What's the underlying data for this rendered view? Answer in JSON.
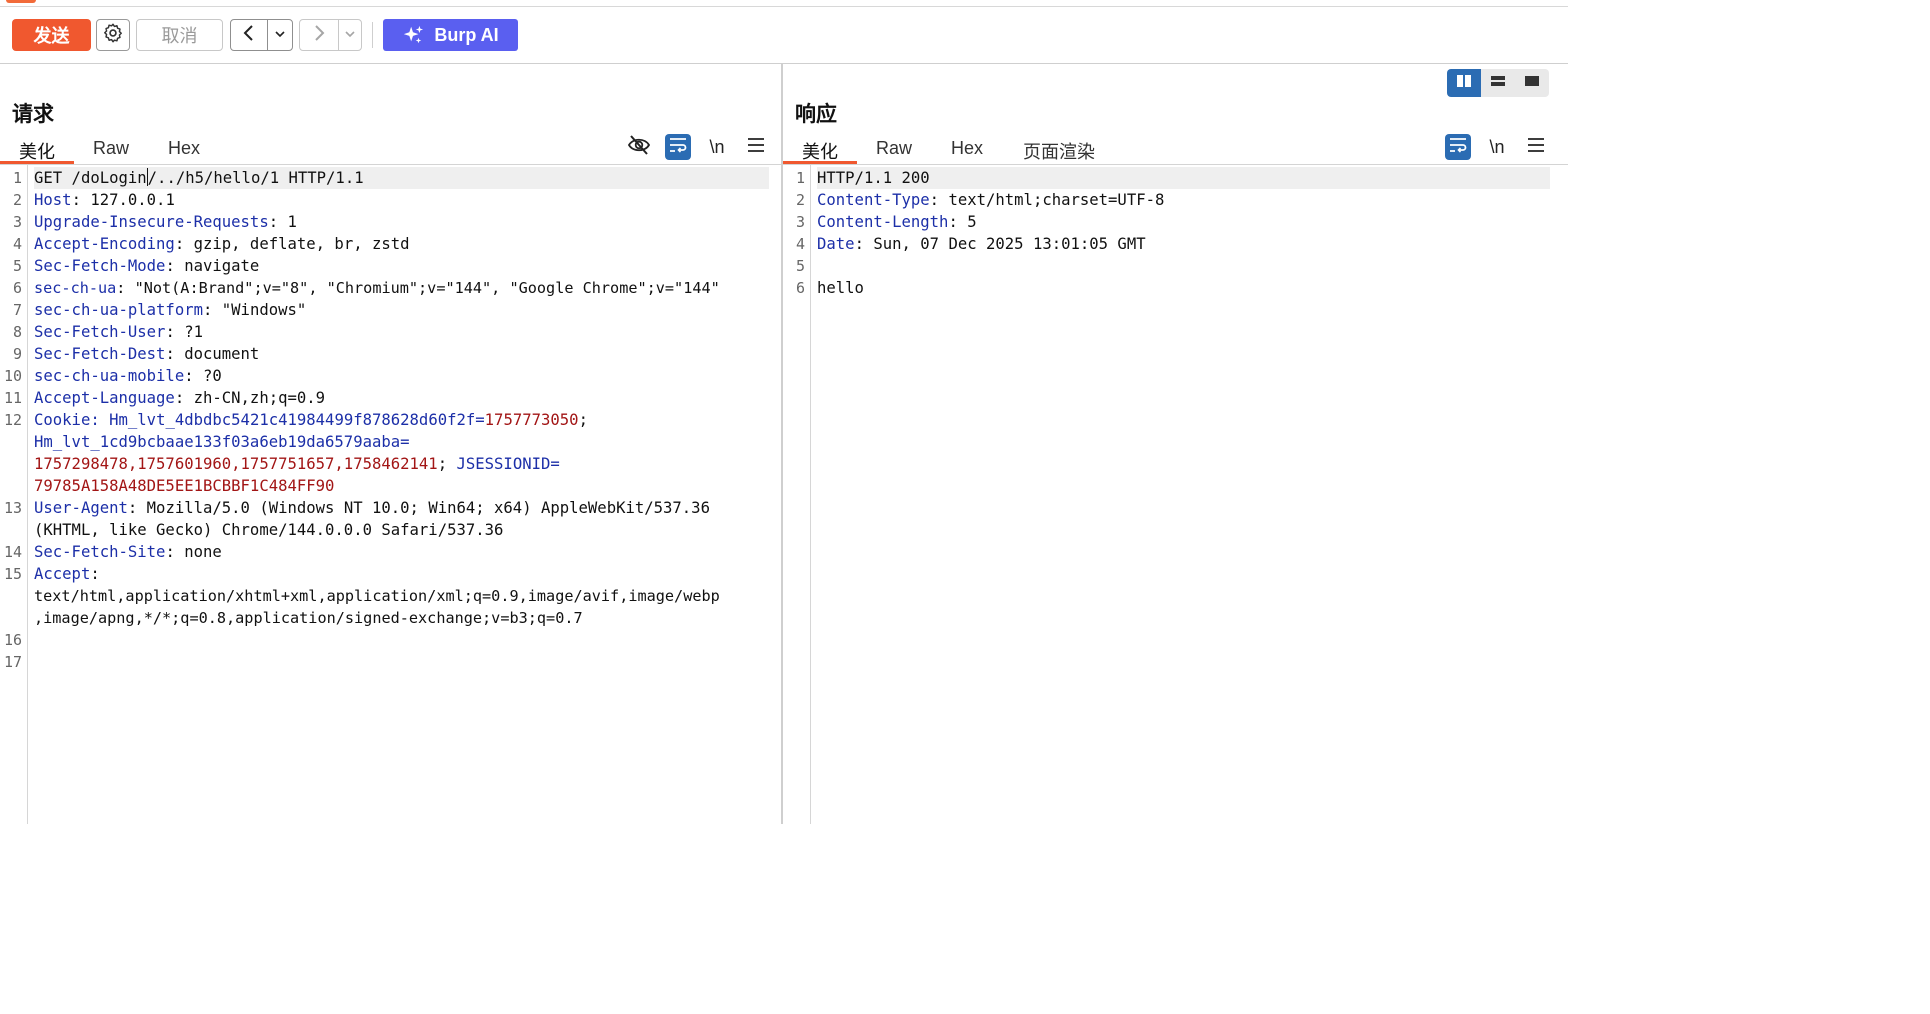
{
  "toolbar": {
    "send_label": "发送",
    "cancel_label": "取消",
    "ai_label": "Burp AI"
  },
  "request": {
    "title": "请求",
    "tabs": [
      "美化",
      "Raw",
      "Hex"
    ],
    "active_tab": "美化",
    "newline_toggle_label": "\\n",
    "line_numbers": [
      "1",
      "2",
      "3",
      "4",
      "5",
      "6",
      "7",
      "8",
      "9",
      "10",
      "11",
      "12",
      "13",
      "14",
      "15",
      "16",
      "17"
    ],
    "lines": {
      "l1a": "GET /doLogin",
      "l1b": "/../h5/hello/1 HTTP/1.1",
      "l2k": "Host",
      "l2v": ": 127.0.0.1",
      "l3k": "Upgrade-Insecure-Requests",
      "l3v": ": 1",
      "l4k": "Accept-Encoding",
      "l4v": ": gzip, deflate, br, zstd",
      "l5k": "Sec-Fetch-Mode",
      "l5v": ": navigate",
      "l6k": "sec-ch-ua",
      "l6v": ": \"Not(A:Brand\";v=\"8\", \"Chromium\";v=\"144\", \"Google Chrome\";v=\"144\"",
      "l7k": "sec-ch-ua-platform",
      "l7v": ": \"Windows\"",
      "l8k": "Sec-Fetch-User",
      "l8v": ": ?1",
      "l9k": "Sec-Fetch-Dest",
      "l9v": ": document",
      "l10k": "sec-ch-ua-mobile",
      "l10v": ": ?0",
      "l11k": "Accept-Language",
      "l11v": ": zh-CN,zh;q=0.9",
      "l12k": "Cookie",
      "l12sep": ": ",
      "c1k": "Hm_lvt_4dbdbc5421c41984499f878628d60f2f",
      "c1eq": "=",
      "c1v": "1757773050",
      "c1end": ";",
      "c2k": "Hm_lvt_1cd9bcbaae133f03a6eb19da6579aaba",
      "c2eq": "=",
      "c2v": "1757298478,1757601960,1757751657,1758462141",
      "c2end": "; ",
      "c3k": "JSESSIONID",
      "c3eq": "=",
      "c3v": "79785A158A48DE5EE1BCBBF1C484FF90",
      "l13k": "User-Agent",
      "l13v": ": Mozilla/5.0 (Windows NT 10.0; Win64; x64) AppleWebKit/537.36",
      "l13c": "(KHTML, like Gecko) Chrome/144.0.0.0 Safari/537.36",
      "l14k": "Sec-Fetch-Site",
      "l14v": ": none",
      "l15k": "Accept",
      "l15v": ":",
      "l15c1": "text/html,application/xhtml+xml,application/xml;q=0.9,image/avif,image/webp",
      "l15c2": ",image/apng,*/*;q=0.8,application/signed-exchange;v=b3;q=0.7"
    }
  },
  "response": {
    "title": "响应",
    "tabs": [
      "美化",
      "Raw",
      "Hex",
      "页面渲染"
    ],
    "active_tab": "美化",
    "newline_toggle_label": "\\n",
    "line_numbers": [
      "1",
      "2",
      "3",
      "4",
      "5",
      "6"
    ],
    "lines": {
      "l1": "HTTP/1.1 200",
      "l2k": "Content-Type",
      "l2v": ": text/html;charset=UTF-8",
      "l3k": "Content-Length",
      "l3v": ": 5",
      "l4k": "Date",
      "l4v": ": Sun, 07 Dec 2025 13:01:05 GMT",
      "l6": "hello"
    }
  },
  "colors": {
    "send": "#f0582f",
    "ai": "#5a5ff0",
    "active_toggle": "#2b6cb3",
    "header_key": "#1c2fa8",
    "cookie_value": "#a21515"
  },
  "icons": [
    "settings-gear-icon",
    "chevron-left-icon",
    "chevron-down-icon",
    "chevron-right-icon",
    "sparkle-icon",
    "eye-off-icon",
    "wrap-icon",
    "newline-icon",
    "menu-icon",
    "layout-split-icon",
    "layout-rows-icon",
    "layout-single-icon"
  ]
}
